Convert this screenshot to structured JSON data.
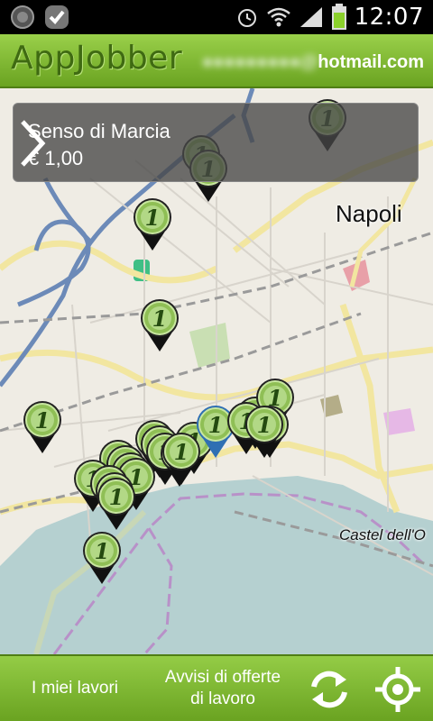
{
  "status_bar": {
    "time": "12:07",
    "icons": [
      "app-notification-icon",
      "checkmark-notification-icon",
      "alarm-icon",
      "wifi-icon",
      "signal-icon",
      "battery-icon"
    ]
  },
  "header": {
    "title": "AppJobber",
    "email_visible": "hotmail.com"
  },
  "map": {
    "labels": {
      "city": "Napoli",
      "castel": "Castel dell'O"
    },
    "marker_badge": "1",
    "marker_count": 27,
    "selected_marker": 1
  },
  "info_panel": {
    "title": "Senso di Marcia",
    "price": "€ 1,00"
  },
  "bottom_bar": {
    "my_jobs": "I miei lavori",
    "offers_line1": "Avvisi di offerte",
    "offers_line2": "di lavoro"
  },
  "colors": {
    "accent_green": "#7cb82f",
    "selected_blue": "#2f6fb3"
  }
}
